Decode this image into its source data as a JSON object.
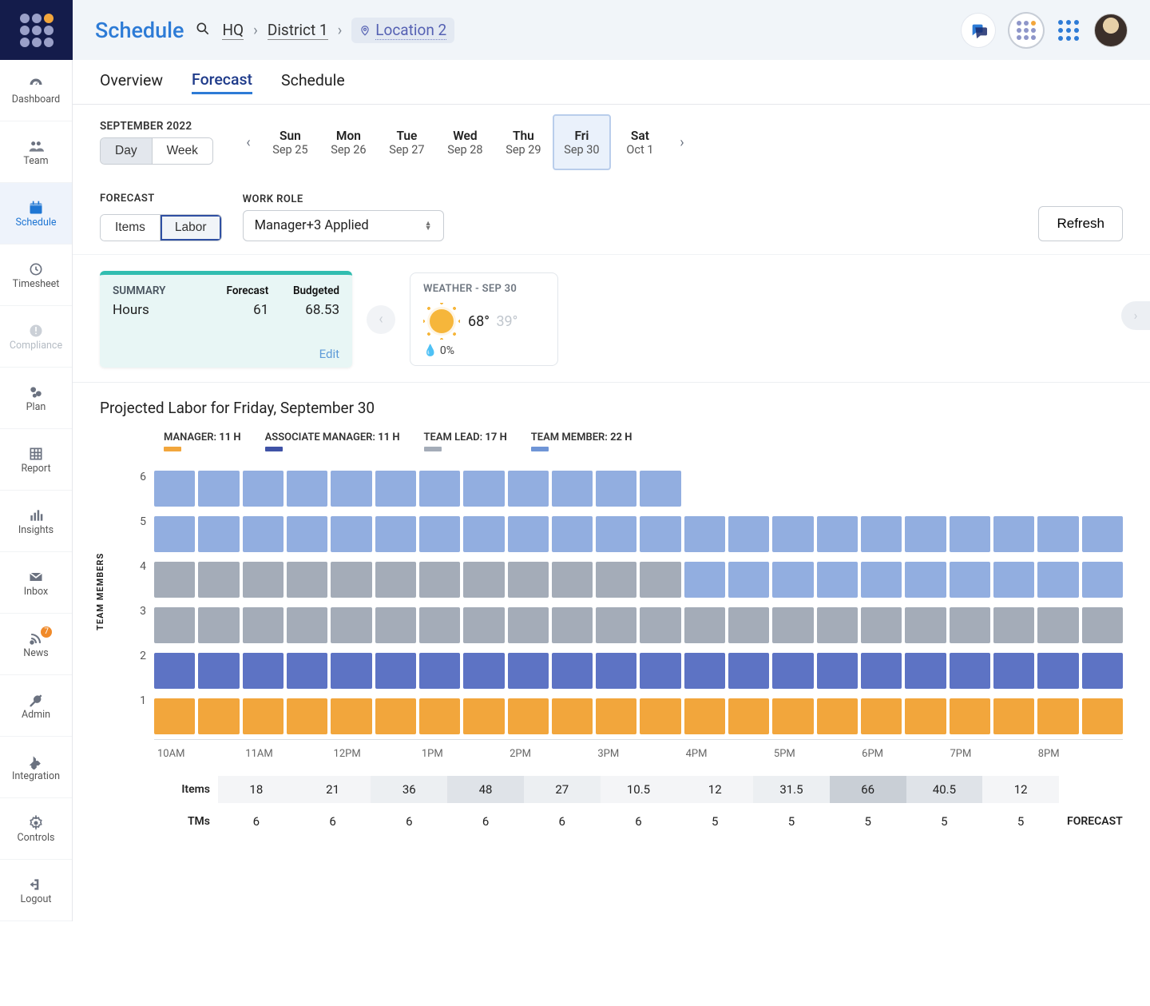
{
  "header": {
    "title": "Schedule",
    "breadcrumb": {
      "hq": "HQ",
      "district": "District 1",
      "location": "Location 2"
    }
  },
  "sidebar": {
    "items": [
      {
        "key": "dashboard",
        "label": "Dashboard"
      },
      {
        "key": "team",
        "label": "Team"
      },
      {
        "key": "schedule",
        "label": "Schedule"
      },
      {
        "key": "timesheet",
        "label": "Timesheet"
      },
      {
        "key": "compliance",
        "label": "Compliance"
      },
      {
        "key": "plan",
        "label": "Plan"
      },
      {
        "key": "report",
        "label": "Report"
      },
      {
        "key": "insights",
        "label": "Insights"
      },
      {
        "key": "inbox",
        "label": "Inbox"
      },
      {
        "key": "news",
        "label": "News",
        "badge": "7"
      },
      {
        "key": "admin",
        "label": "Admin"
      },
      {
        "key": "integration",
        "label": "Integration"
      },
      {
        "key": "controls",
        "label": "Controls"
      },
      {
        "key": "logout",
        "label": "Logout"
      }
    ]
  },
  "tabs": {
    "overview": "Overview",
    "forecast": "Forecast",
    "schedule": "Schedule"
  },
  "period": {
    "label": "SEPTEMBER 2022",
    "mode_day": "Day",
    "mode_week": "Week",
    "days": [
      {
        "d": "Sun",
        "date": "Sep 25"
      },
      {
        "d": "Mon",
        "date": "Sep 26"
      },
      {
        "d": "Tue",
        "date": "Sep 27"
      },
      {
        "d": "Wed",
        "date": "Sep 28"
      },
      {
        "d": "Thu",
        "date": "Sep 29"
      },
      {
        "d": "Fri",
        "date": "Sep 30"
      },
      {
        "d": "Sat",
        "date": "Oct 1"
      }
    ]
  },
  "filters": {
    "forecast_label": "FORECAST",
    "forecast_items": "Items",
    "forecast_labor": "Labor",
    "workrole_label": "WORK ROLE",
    "workrole_value": "Manager+3 Applied",
    "refresh": "Refresh"
  },
  "summary": {
    "title": "SUMMARY",
    "col_forecast": "Forecast",
    "col_budgeted": "Budgeted",
    "row_label": "Hours",
    "forecast_value": "61",
    "budgeted_value": "68.53",
    "edit": "Edit"
  },
  "weather": {
    "title": "WEATHER - SEP 30",
    "hi": "68°",
    "lo": "39°",
    "precip": "0%"
  },
  "chart": {
    "title": "Projected Labor for Friday, September 30",
    "legend": [
      {
        "name": "MANAGER",
        "hours": "11 H",
        "color": "#f2a63c"
      },
      {
        "name": "ASSOCIATE MANAGER",
        "hours": "11 H",
        "color": "#3f52a6"
      },
      {
        "name": "TEAM LEAD",
        "hours": "17 H",
        "color": "#a4acb8"
      },
      {
        "name": "TEAM MEMBER",
        "hours": "22 H",
        "color": "#6f95d6"
      }
    ],
    "y_title": "TEAM MEMBERS",
    "y_ticks": [
      "6",
      "5",
      "4",
      "3",
      "2",
      "1"
    ],
    "x_ticks": [
      "10AM",
      "11AM",
      "12PM",
      "1PM",
      "2PM",
      "3PM",
      "4PM",
      "5PM",
      "6PM",
      "7PM",
      "8PM"
    ]
  },
  "chart_data": {
    "type": "bar",
    "stacked": true,
    "time_slots_half_hour": [
      "10:00",
      "10:30",
      "11:00",
      "11:30",
      "12:00",
      "12:30",
      "13:00",
      "13:30",
      "14:00",
      "14:30",
      "15:00",
      "15:30",
      "16:00",
      "16:30",
      "17:00",
      "17:30",
      "18:00",
      "18:30",
      "19:00",
      "19:30",
      "20:00",
      "20:30"
    ],
    "series": [
      {
        "name": "MANAGER",
        "color": "#f2a63c",
        "values": [
          1,
          1,
          1,
          1,
          1,
          1,
          1,
          1,
          1,
          1,
          1,
          1,
          1,
          1,
          1,
          1,
          1,
          1,
          1,
          1,
          1,
          1
        ]
      },
      {
        "name": "ASSOCIATE MANAGER",
        "color": "#3f52a6",
        "values": [
          1,
          1,
          1,
          1,
          1,
          1,
          1,
          1,
          1,
          1,
          1,
          1,
          1,
          1,
          1,
          1,
          1,
          1,
          1,
          1,
          1,
          1
        ]
      },
      {
        "name": "TEAM LEAD",
        "color": "#a4acb8",
        "values": [
          2,
          2,
          2,
          2,
          2,
          2,
          2,
          2,
          2,
          2,
          2,
          2,
          1,
          1,
          1,
          1,
          1,
          1,
          1,
          1,
          1,
          1
        ]
      },
      {
        "name": "TEAM MEMBER",
        "color": "#92aee0",
        "values": [
          2,
          2,
          2,
          2,
          2,
          2,
          2,
          2,
          2,
          2,
          2,
          2,
          2,
          2,
          2,
          2,
          2,
          2,
          2,
          2,
          2,
          2
        ]
      }
    ],
    "y_stacks_visual": [
      [
        "tm",
        "tm",
        "tm",
        "tm",
        "tm",
        "tm",
        "tm",
        "tm",
        "tm",
        "tm",
        "tm",
        "tm",
        "",
        "",
        "",
        "",
        "",
        "",
        "",
        "",
        "",
        ""
      ],
      [
        "tm",
        "tm",
        "tm",
        "tm",
        "tm",
        "tm",
        "tm",
        "tm",
        "tm",
        "tm",
        "tm",
        "tm",
        "tm",
        "tm",
        "tm",
        "tm",
        "tm",
        "tm",
        "tm",
        "tm",
        "tm",
        "tm"
      ],
      [
        "tl",
        "tl",
        "tl",
        "tl",
        "tl",
        "tl",
        "tl",
        "tl",
        "tl",
        "tl",
        "tl",
        "tl",
        "tm",
        "tm",
        "tm",
        "tm",
        "tm",
        "tm",
        "tm",
        "tm",
        "tm",
        "tm"
      ],
      [
        "tl",
        "tl",
        "tl",
        "tl",
        "tl",
        "tl",
        "tl",
        "tl",
        "tl",
        "tl",
        "tl",
        "tl",
        "tl",
        "tl",
        "tl",
        "tl",
        "tl",
        "tl",
        "tl",
        "tl",
        "tl",
        "tl"
      ],
      [
        "am",
        "am",
        "am",
        "am",
        "am",
        "am",
        "am",
        "am",
        "am",
        "am",
        "am",
        "am",
        "am",
        "am",
        "am",
        "am",
        "am",
        "am",
        "am",
        "am",
        "am",
        "am"
      ],
      [
        "mg",
        "mg",
        "mg",
        "mg",
        "mg",
        "mg",
        "mg",
        "mg",
        "mg",
        "mg",
        "mg",
        "mg",
        "mg",
        "mg",
        "mg",
        "mg",
        "mg",
        "mg",
        "mg",
        "mg",
        "mg",
        "mg"
      ]
    ],
    "role_colors": {
      "mg": "#f2a63c",
      "am": "#5d73c4",
      "tl": "#a4acb8",
      "tm": "#92aee0"
    },
    "ylabel": "TEAM MEMBERS",
    "ylim": [
      0,
      6
    ]
  },
  "forecast_table": {
    "label_items": "Items",
    "label_tms": "TMs",
    "label_forecast": "FORECAST",
    "items": [
      "18",
      "21",
      "36",
      "48",
      "27",
      "10.5",
      "12",
      "31.5",
      "66",
      "40.5",
      "12"
    ],
    "items_shade": [
      "a",
      "a",
      "b",
      "c",
      "b",
      "a",
      "a",
      "b",
      "d",
      "c",
      "a"
    ],
    "tms": [
      "6",
      "6",
      "6",
      "6",
      "6",
      "6",
      "5",
      "5",
      "5",
      "5",
      "5"
    ]
  }
}
